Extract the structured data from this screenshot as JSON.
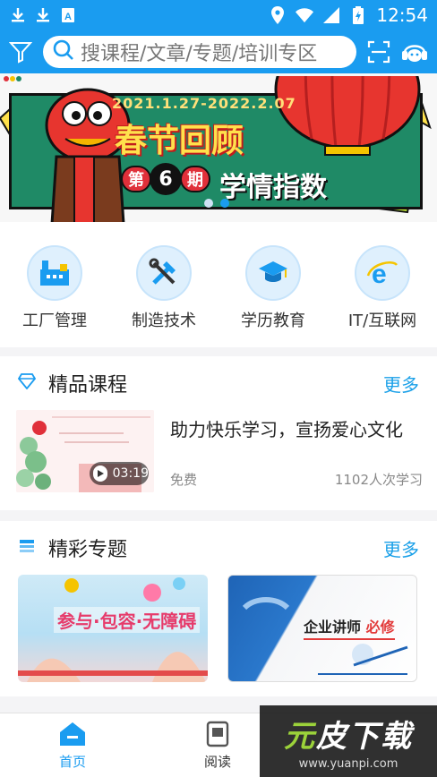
{
  "status": {
    "time": "12:54"
  },
  "header": {
    "search_placeholder": "搜课程/文章/专题/培训专区"
  },
  "banner": {
    "date_range": "2021.1.27-2022.2.07",
    "title": "春节回顾",
    "issue_prefix": "第",
    "issue_number": "6",
    "issue_suffix": "期",
    "subtitle": "学情指数",
    "page_count": 2,
    "active_page": 2
  },
  "categories": [
    {
      "label": "工厂管理",
      "icon": "factory-icon"
    },
    {
      "label": "制造技术",
      "icon": "tools-icon"
    },
    {
      "label": "学历教育",
      "icon": "graduation-cap-icon"
    },
    {
      "label": "IT/互联网",
      "icon": "internet-explorer-icon"
    }
  ],
  "featured_courses": {
    "title": "精品课程",
    "more": "更多",
    "items": [
      {
        "title": "助力快乐学习，宣扬爱心文化",
        "price": "免费",
        "learners": "1102人次学习",
        "duration": "03:19"
      }
    ]
  },
  "featured_topics": {
    "title": "精彩专题",
    "more": "更多",
    "items": [
      {
        "image_text": "参与·包容·无障碍"
      },
      {
        "image_text_a": "企业讲师",
        "image_text_b": "必修"
      }
    ]
  },
  "bottom_nav": {
    "items": [
      {
        "label": "首页",
        "icon": "home-icon"
      },
      {
        "label": "阅读",
        "icon": "book-icon"
      }
    ]
  },
  "watermark": {
    "logo_a": "元",
    "logo_b": "皮下载",
    "url": "www.yuanpi.com"
  },
  "colors": {
    "primary": "#1a9cf0",
    "more_link": "#1aa0e8"
  }
}
